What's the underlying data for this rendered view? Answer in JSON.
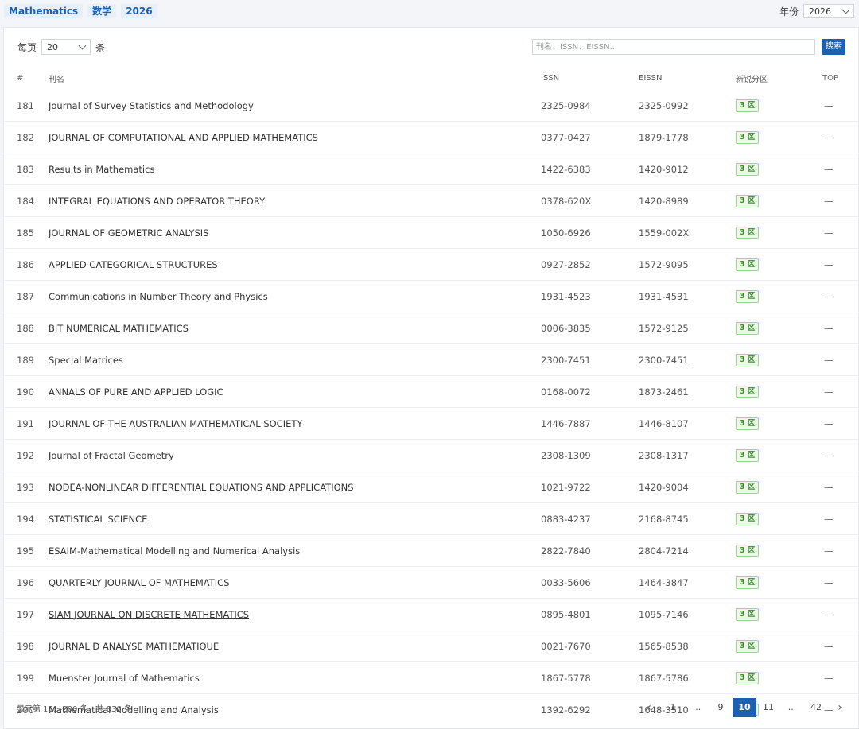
{
  "filters": {
    "chips": [
      "Mathematics",
      "数学",
      "2026"
    ],
    "year_label": "年份",
    "year_value": "2026"
  },
  "toolbar": {
    "per_page_prefix": "每页",
    "per_page_value": "20",
    "per_page_suffix": "条",
    "search_placeholder": "刊名、ISSN、EISSN...",
    "search_button": "搜索"
  },
  "table": {
    "headers": [
      "#",
      "刊名",
      "ISSN",
      "EISSN",
      "新锐分区",
      "TOP"
    ],
    "rows": [
      {
        "idx": "181",
        "name": "Journal of Survey Statistics and Methodology",
        "issn": "2325-0984",
        "eissn": "2325-0992",
        "zone": "3 区",
        "top": "—"
      },
      {
        "idx": "182",
        "name": "JOURNAL OF COMPUTATIONAL AND APPLIED MATHEMATICS",
        "issn": "0377-0427",
        "eissn": "1879-1778",
        "zone": "3 区",
        "top": "—"
      },
      {
        "idx": "183",
        "name": "Results in Mathematics",
        "issn": "1422-6383",
        "eissn": "1420-9012",
        "zone": "3 区",
        "top": "—"
      },
      {
        "idx": "184",
        "name": "INTEGRAL EQUATIONS AND OPERATOR THEORY",
        "issn": "0378-620X",
        "eissn": "1420-8989",
        "zone": "3 区",
        "top": "—"
      },
      {
        "idx": "185",
        "name": "JOURNAL OF GEOMETRIC ANALYSIS",
        "issn": "1050-6926",
        "eissn": "1559-002X",
        "zone": "3 区",
        "top": "—"
      },
      {
        "idx": "186",
        "name": "APPLIED CATEGORICAL STRUCTURES",
        "issn": "0927-2852",
        "eissn": "1572-9095",
        "zone": "3 区",
        "top": "—"
      },
      {
        "idx": "187",
        "name": "Communications in Number Theory and Physics",
        "issn": "1931-4523",
        "eissn": "1931-4531",
        "zone": "3 区",
        "top": "—"
      },
      {
        "idx": "188",
        "name": "BIT NUMERICAL MATHEMATICS",
        "issn": "0006-3835",
        "eissn": "1572-9125",
        "zone": "3 区",
        "top": "—"
      },
      {
        "idx": "189",
        "name": "Special Matrices",
        "issn": "2300-7451",
        "eissn": "2300-7451",
        "zone": "3 区",
        "top": "—"
      },
      {
        "idx": "190",
        "name": "ANNALS OF PURE AND APPLIED LOGIC",
        "issn": "0168-0072",
        "eissn": "1873-2461",
        "zone": "3 区",
        "top": "—"
      },
      {
        "idx": "191",
        "name": "JOURNAL OF THE AUSTRALIAN MATHEMATICAL SOCIETY",
        "issn": "1446-7887",
        "eissn": "1446-8107",
        "zone": "3 区",
        "top": "—"
      },
      {
        "idx": "192",
        "name": "Journal of Fractal Geometry",
        "issn": "2308-1309",
        "eissn": "2308-1317",
        "zone": "3 区",
        "top": "—"
      },
      {
        "idx": "193",
        "name": "NODEA-NONLINEAR DIFFERENTIAL EQUATIONS AND APPLICATIONS",
        "issn": "1021-9722",
        "eissn": "1420-9004",
        "zone": "3 区",
        "top": "—"
      },
      {
        "idx": "194",
        "name": "STATISTICAL SCIENCE",
        "issn": "0883-4237",
        "eissn": "2168-8745",
        "zone": "3 区",
        "top": "—"
      },
      {
        "idx": "195",
        "name": "ESAIM-Mathematical Modelling and Numerical Analysis",
        "issn": "2822-7840",
        "eissn": "2804-7214",
        "zone": "3 区",
        "top": "—"
      },
      {
        "idx": "196",
        "name": "QUARTERLY JOURNAL OF MATHEMATICS",
        "issn": "0033-5606",
        "eissn": "1464-3847",
        "zone": "3 区",
        "top": "—"
      },
      {
        "idx": "197",
        "name": "SIAM JOURNAL ON DISCRETE MATHEMATICS",
        "issn": "0895-4801",
        "eissn": "1095-7146",
        "zone": "3 区",
        "top": "—",
        "hovered": true
      },
      {
        "idx": "198",
        "name": "JOURNAL D ANALYSE MATHEMATIQUE",
        "issn": "0021-7670",
        "eissn": "1565-8538",
        "zone": "3 区",
        "top": "—"
      },
      {
        "idx": "199",
        "name": "Muenster Journal of Mathematics",
        "issn": "1867-5778",
        "eissn": "1867-5786",
        "zone": "3 区",
        "top": "—"
      },
      {
        "idx": "200",
        "name": "Mathematical Modelling and Analysis",
        "issn": "1392-6292",
        "eissn": "1648-3510",
        "zone": "3 区",
        "top": "—"
      }
    ]
  },
  "footer": {
    "summary": "显示第 181–200 条，共 830 条",
    "pages": [
      "1",
      "...",
      "9",
      "10",
      "11",
      "...",
      "42"
    ],
    "current_page": "10",
    "prev_symbol": "‹",
    "next_symbol": "›"
  },
  "colors": {
    "accent": "#1d5fb0",
    "zone_bg": "#ecf8e8",
    "zone_border": "#9fd292",
    "zone_text": "#3c8a2c"
  }
}
